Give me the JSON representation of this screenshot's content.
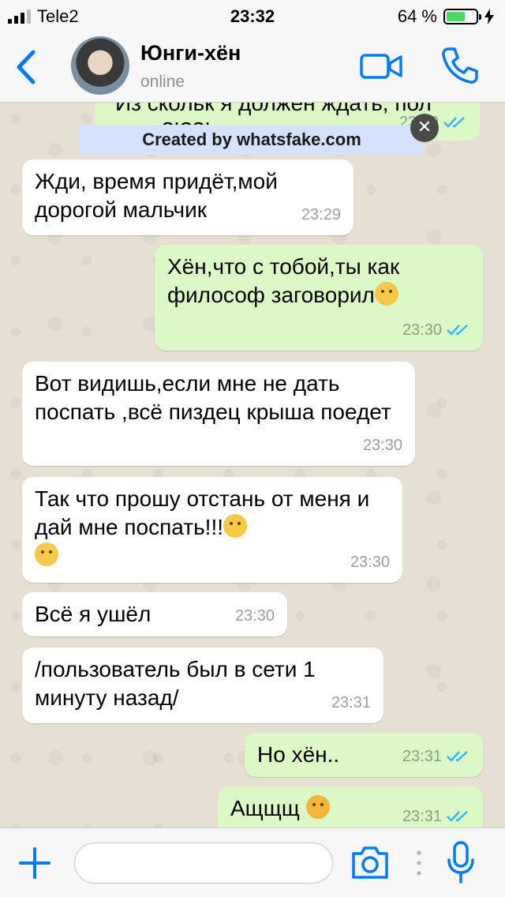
{
  "status_bar": {
    "carrier": "Tele2",
    "time": "23:32",
    "battery_percent": "64 %",
    "battery_level": 0.64
  },
  "header": {
    "contact_name": "Юнги-хён",
    "contact_status": "online",
    "icons": [
      "back-chevron-icon",
      "avatar",
      "video-call-icon",
      "phone-call-icon"
    ]
  },
  "watermark": {
    "text": "Created by whatsfake.com",
    "close_label": "✕"
  },
  "messages": [
    {
      "dir": "out",
      "text": "Из скольк я должен ждать, пол века?!??!",
      "time": "23:29",
      "read": true,
      "partial": true
    },
    {
      "dir": "in",
      "text": "Жди, время придёт,мой дорогой мальчик",
      "time": "23:29"
    },
    {
      "dir": "out",
      "text": "Хён,что с тобой,ты как философ заговорил",
      "emoji": "face-with-hand-over-mouth",
      "time": "23:30",
      "read": true
    },
    {
      "dir": "in",
      "text": "Вот видишь,если мне не дать поспать ,всё  пиздец крыша поедет",
      "time": "23:30"
    },
    {
      "dir": "in",
      "text": "Так что прошу отстань от меня и дай мне поспать!!!",
      "emoji": "face-with-rolling-eyes, expressionless-face",
      "time": "23:30"
    },
    {
      "dir": "in",
      "text": "Всё я ушёл",
      "time": "23:30"
    },
    {
      "dir": "in",
      "text": "/пользователь был в сети 1 минуту назад/",
      "time": "23:31"
    },
    {
      "dir": "out",
      "text": "Но хён..",
      "time": "23:31",
      "read": true
    },
    {
      "dir": "out",
      "text": "Ащщщ",
      "emoji": "tired-face",
      "time": "23:31",
      "read": true
    }
  ],
  "input_bar": {
    "placeholder": "",
    "icons": [
      "plus-icon",
      "camera-icon",
      "more-dots-icon",
      "microphone-icon"
    ]
  },
  "colors": {
    "accent": "#007aff",
    "outgoing_bubble": "#dcf8c6",
    "incoming_bubble": "#ffffff",
    "read_ticks": "#34b7f1",
    "chat_background": "#e6dfd4"
  }
}
